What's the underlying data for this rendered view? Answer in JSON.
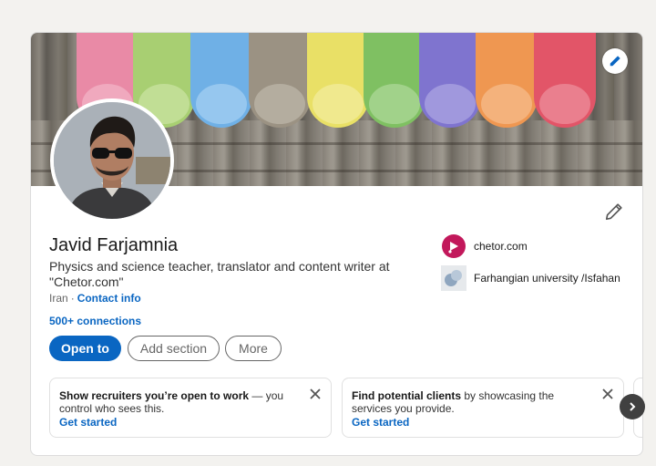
{
  "profile": {
    "name": "Javid Farjamnia",
    "headline": "Physics and science teacher, translator and content writer at \"Chetor.com\"",
    "location": "Iran",
    "separator": "·",
    "contact_info": "Contact info",
    "connections": "500+ connections"
  },
  "actions": {
    "open_to": "Open to",
    "add_section": "Add section",
    "more": "More"
  },
  "companies": [
    {
      "name": "chetor.com",
      "logo": "chetor-logo",
      "color": "#c2185b"
    },
    {
      "name": "Farhangian university /Isfahan",
      "logo": "university-logo"
    }
  ],
  "promos": [
    {
      "bold": "Show recruiters you’re open to work",
      "rest": " — you control who sees this.",
      "link": "Get started"
    },
    {
      "bold": "Find potential clients",
      "rest": " by showcasing the services you provide.",
      "link": "Get started"
    }
  ],
  "icons": {
    "cover_edit": "pencil-icon",
    "intro_edit": "pencil-icon",
    "close": "close-icon",
    "next": "chevron-right-icon"
  },
  "colors": {
    "primary": "#0a66c2",
    "page_bg": "#f3f2ef",
    "chalk": [
      "#e98aa6",
      "#a8cf72",
      "#6fb0e6",
      "#9b9283",
      "#e9e066",
      "#7fc062",
      "#7f74cf",
      "#ef9751",
      "#e25568"
    ]
  }
}
